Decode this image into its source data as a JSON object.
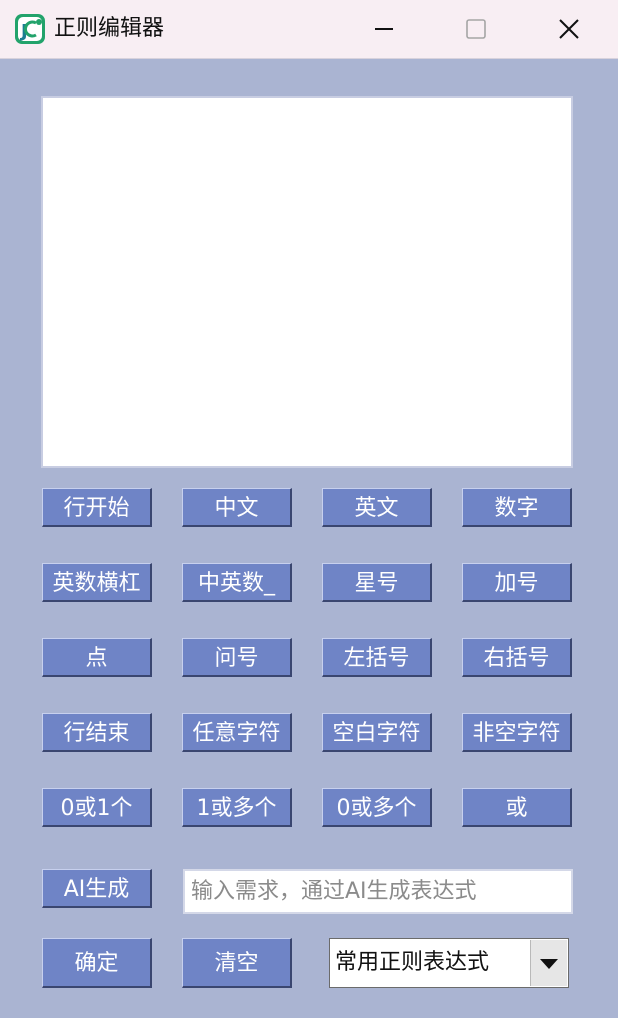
{
  "window": {
    "title": "正则编辑器",
    "icon": "regex-app-icon"
  },
  "editor": {
    "value": ""
  },
  "buttons": {
    "row1": [
      "行开始",
      "中文",
      "英文",
      "数字"
    ],
    "row2": [
      "英数横杠",
      "中英数_",
      "星号",
      "加号"
    ],
    "row3": [
      "点",
      "问号",
      "左括号",
      "右括号"
    ],
    "row4": [
      "行结束",
      "任意字符",
      "空白字符",
      "非空字符"
    ],
    "row5": [
      "0或1个",
      "1或多个",
      "0或多个",
      "或"
    ]
  },
  "ai": {
    "button_label": "AI生成",
    "input_value": "",
    "input_placeholder": "输入需求，通过AI生成表达式"
  },
  "footer": {
    "confirm_label": "确定",
    "clear_label": "清空",
    "preset_selected": "常用正则表达式"
  },
  "colors": {
    "window_bg": "#aab4d2",
    "titlebar_bg": "#f8eef3",
    "button_bg": "#6f84c6",
    "button_text": "#ffffff"
  }
}
